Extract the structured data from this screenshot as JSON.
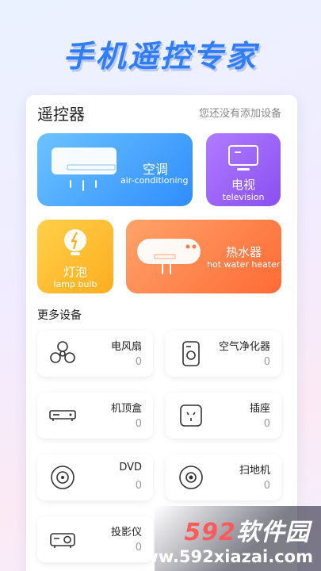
{
  "banner": {
    "title": "手机遥控专家"
  },
  "remote": {
    "title": "遥控器",
    "no_device": "您还没有添加设备"
  },
  "tiles": {
    "ac": {
      "label": "空调",
      "sub": "air-conditioning"
    },
    "tv": {
      "label": "电视",
      "sub": "television"
    },
    "lamp": {
      "label": "灯泡",
      "sub": "lamp bulb"
    },
    "heater": {
      "label": "热水器",
      "sub": "hot water heater"
    }
  },
  "more": {
    "title": "更多设备",
    "devices": [
      {
        "name": "电风扇",
        "count": "0",
        "icon": "fan-icon"
      },
      {
        "name": "空气净化器",
        "count": "0",
        "icon": "air-purifier-icon"
      },
      {
        "name": "机顶盒",
        "count": "0",
        "icon": "set-top-box-icon"
      },
      {
        "name": "插座",
        "count": "0",
        "icon": "socket-icon"
      },
      {
        "name": "DVD",
        "count": "0",
        "icon": "dvd-icon"
      },
      {
        "name": "扫地机",
        "count": "0",
        "icon": "robot-vacuum-icon"
      },
      {
        "name": "投影仪",
        "count": "0",
        "icon": "projector-icon"
      }
    ]
  },
  "watermark": {
    "logo_num": "592",
    "logo_text": "软件园",
    "url": "www.592xiazai.com"
  },
  "colors": {
    "accent": "#2f7ef5",
    "ac": "#2f8dfb",
    "tv": "#8a4ff0",
    "lamp": "#ffad1e",
    "heater": "#ff6a35"
  }
}
